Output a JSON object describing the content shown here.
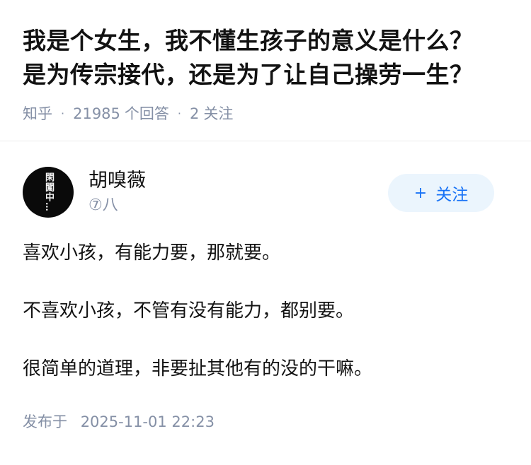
{
  "question": {
    "title_line1": "我是个女生，我不懂生孩子的意义是什么？",
    "title_line2": "是为传宗接代，还是为了让自己操劳一生？",
    "source": "知乎",
    "answer_count": "21985",
    "answer_label": "个回答",
    "follower_count": "2",
    "follower_label": "关注"
  },
  "answer": {
    "author": {
      "name": "胡嗅薇",
      "badge": "⑦八",
      "avatar_text": "閑闖中…",
      "avatar_icon": "calligraphy-avatar"
    },
    "follow_button": {
      "icon": "plus-icon",
      "label": "关注"
    },
    "paragraphs": [
      "喜欢小孩，有能力要，那就要。",
      "不喜欢小孩，不管有没有能力，都别要。",
      "很简单的道理，非要扯其他有的没的干嘛。"
    ],
    "publish": {
      "label": "发布于",
      "time": "2025-11-01 22:23"
    }
  },
  "colors": {
    "text_primary": "#121212",
    "text_secondary": "#8590a6",
    "accent_blue": "#1772f6",
    "follow_bg": "#ebf5fd"
  }
}
